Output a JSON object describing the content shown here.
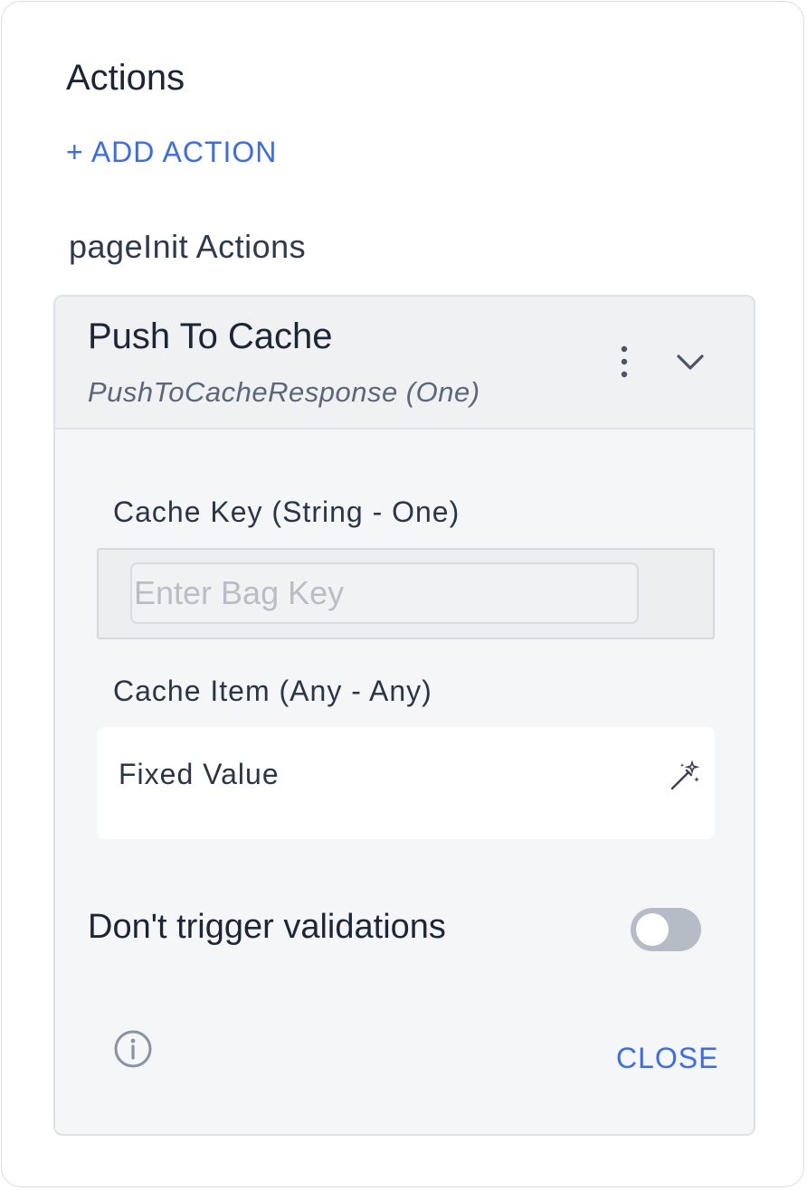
{
  "panel": {
    "title": "Actions",
    "add_action_label": "+ ADD ACTION",
    "section_title": "pageInit Actions"
  },
  "action_card": {
    "title": "Push To Cache",
    "subtitle": "PushToCacheResponse (One)",
    "menu_icon": "kebab-vertical-icon",
    "expand_icon": "chevron-down-icon",
    "cache_key": {
      "label": "Cache Key (String - One)",
      "value": "",
      "placeholder": "Enter Bag Key"
    },
    "cache_item": {
      "label": "Cache Item (Any - Any)",
      "value": "Fixed Value",
      "icon": "magic-wand-icon"
    },
    "toggle": {
      "label": "Don't trigger validations",
      "state": "off"
    },
    "footer": {
      "info_icon": "info-icon",
      "close_label": "CLOSE"
    }
  },
  "colors": {
    "accent": "#3b6cf0",
    "toggle_off": "#b6bcc6",
    "card_bg": "#f5f6f8",
    "header_bg": "#eff1f3"
  }
}
